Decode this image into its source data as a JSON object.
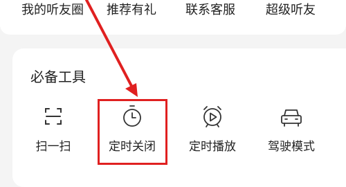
{
  "top_row": {
    "items": [
      {
        "label": "我的听友圈"
      },
      {
        "label": "推荐有礼"
      },
      {
        "label": "联系客服"
      },
      {
        "label": "超级听友"
      }
    ]
  },
  "tools_section": {
    "title": "必备工具",
    "tools": [
      {
        "label": "扫一扫",
        "icon": "scan-icon"
      },
      {
        "label": "定时关闭",
        "icon": "timer-icon"
      },
      {
        "label": "定时播放",
        "icon": "alarm-play-icon"
      },
      {
        "label": "驾驶模式",
        "icon": "car-icon"
      }
    ]
  },
  "annotation": {
    "color": "#e02020"
  }
}
